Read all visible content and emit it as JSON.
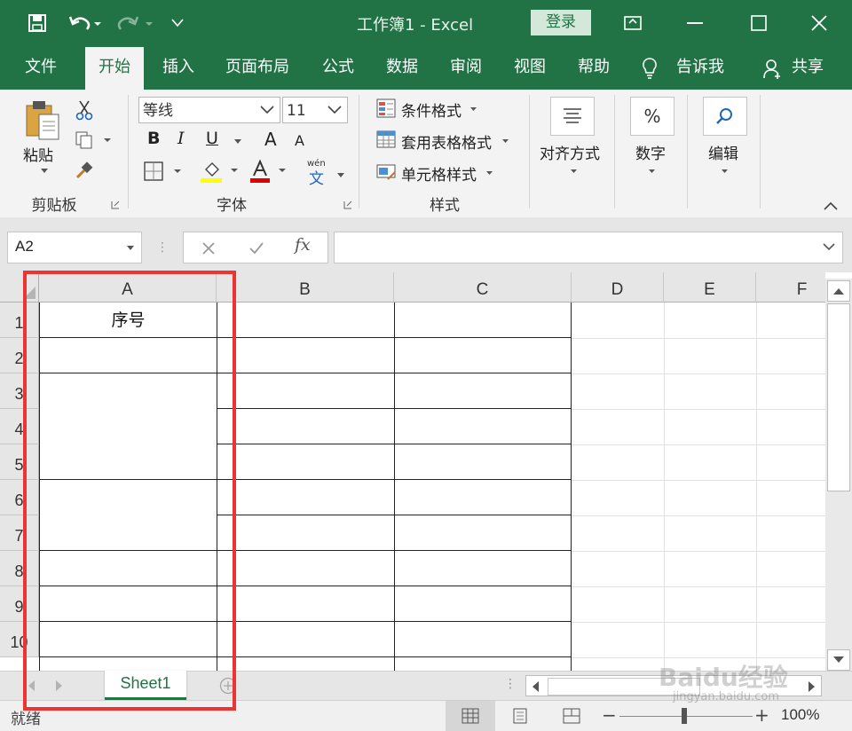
{
  "window": {
    "doc_title": "工作簿1 - Excel",
    "login_label": "登录",
    "tell_me": "告诉我",
    "share": "共享",
    "colors": {
      "accent": "#217346",
      "highlight_box": "#ee3333"
    }
  },
  "tabs": [
    "文件",
    "开始",
    "插入",
    "页面布局",
    "公式",
    "数据",
    "审阅",
    "视图",
    "帮助"
  ],
  "ribbon": {
    "clipboard": {
      "paste": "粘贴",
      "group": "剪贴板"
    },
    "font": {
      "name": "等线",
      "size": "11",
      "bold": "B",
      "italic": "I",
      "underline": "U",
      "grow": "A",
      "shrink": "A",
      "font_color": "A",
      "phonetic_top": "wén",
      "phonetic": "文",
      "group": "字体"
    },
    "styles": {
      "conditional": "条件格式",
      "table": "套用表格格式",
      "cell": "单元格样式",
      "group": "样式"
    },
    "alignment": "对齐方式",
    "number": {
      "label": "数字",
      "symbol": "%"
    },
    "editing": "编辑"
  },
  "formula_bar": {
    "name_box": "A2",
    "fx": "fx",
    "formula": ""
  },
  "columns": [
    "A",
    "B",
    "C",
    "D",
    "E",
    "F"
  ],
  "rows": [
    "1",
    "2",
    "3",
    "4",
    "5",
    "6",
    "7",
    "8",
    "9",
    "10"
  ],
  "cells": {
    "A1": "序号"
  },
  "sheet_tab": "Sheet1",
  "status": {
    "ready": "就绪",
    "zoom": "100%"
  },
  "watermark": {
    "text": "Baidu经验",
    "sub": "jingyan.baidu.com"
  }
}
